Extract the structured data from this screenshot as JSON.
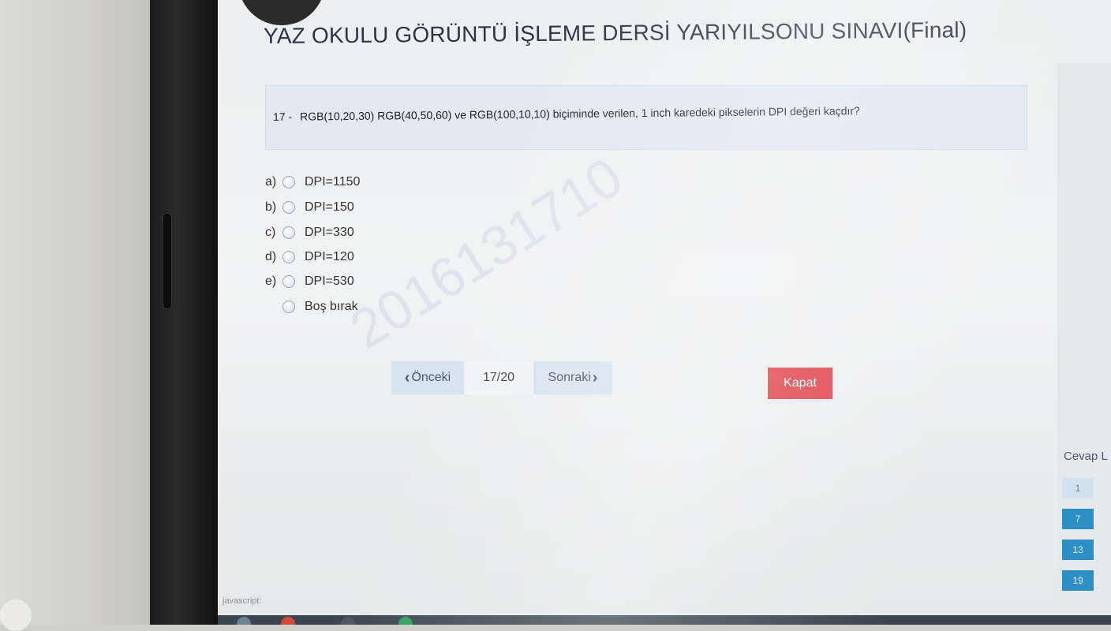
{
  "exam": {
    "title": "YAZ OKULU GÖRÜNTÜ İŞLEME DERSİ YARIYILSONU SINAVI(Final)"
  },
  "question": {
    "number": "17 -",
    "text": "RGB(10,20,30) RGB(40,50,60) ve RGB(100,10,10) biçiminde verilen, 1 inch karedeki pikselerin DPI değeri kaçdır?"
  },
  "options": [
    {
      "letter": "a)",
      "label": "DPI=1150"
    },
    {
      "letter": "b)",
      "label": "DPI=150"
    },
    {
      "letter": "c)",
      "label": "DPI=330"
    },
    {
      "letter": "d)",
      "label": "DPI=120"
    },
    {
      "letter": "e)",
      "label": "DPI=530"
    },
    {
      "letter": "",
      "label": "Boş bırak"
    }
  ],
  "watermark": "2016131710",
  "navigation": {
    "prev_icon": "‹",
    "prev_label": "Önceki",
    "page": "17/20",
    "next_label": "Sonraki",
    "next_icon": "›",
    "close_label": "Kapat"
  },
  "answers_panel": {
    "label": "Cevap L",
    "items": [
      "1",
      "7",
      "13",
      "19"
    ]
  },
  "status_bar": {
    "text": "javascript:"
  },
  "colors": {
    "close_button": "#e0484d",
    "answered": "#2e8fc4",
    "unanswered": "#d3e2ef",
    "question_box": "#e2e9f1"
  }
}
